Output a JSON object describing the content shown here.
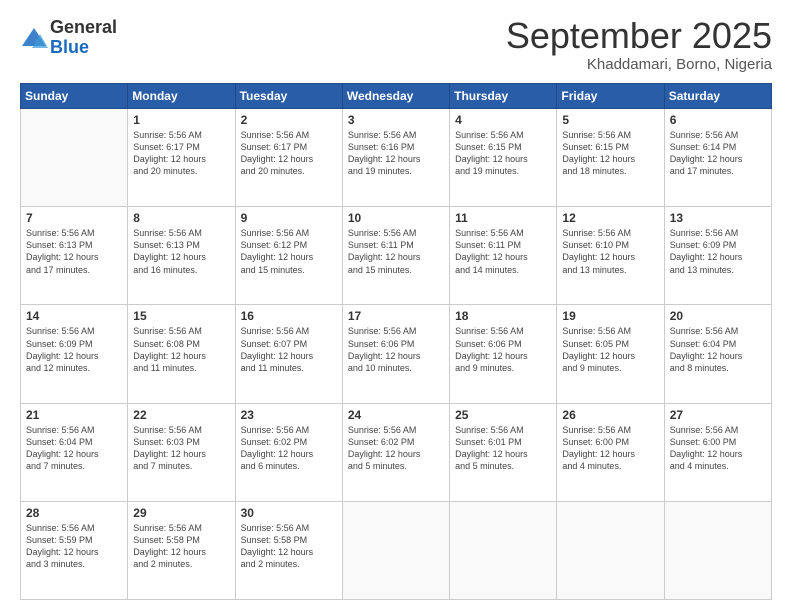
{
  "header": {
    "logo_general": "General",
    "logo_blue": "Blue",
    "month_title": "September 2025",
    "subtitle": "Khaddamari, Borno, Nigeria"
  },
  "days_of_week": [
    "Sunday",
    "Monday",
    "Tuesday",
    "Wednesday",
    "Thursday",
    "Friday",
    "Saturday"
  ],
  "weeks": [
    [
      {
        "day": "",
        "info": ""
      },
      {
        "day": "1",
        "info": "Sunrise: 5:56 AM\nSunset: 6:17 PM\nDaylight: 12 hours\nand 20 minutes."
      },
      {
        "day": "2",
        "info": "Sunrise: 5:56 AM\nSunset: 6:17 PM\nDaylight: 12 hours\nand 20 minutes."
      },
      {
        "day": "3",
        "info": "Sunrise: 5:56 AM\nSunset: 6:16 PM\nDaylight: 12 hours\nand 19 minutes."
      },
      {
        "day": "4",
        "info": "Sunrise: 5:56 AM\nSunset: 6:15 PM\nDaylight: 12 hours\nand 19 minutes."
      },
      {
        "day": "5",
        "info": "Sunrise: 5:56 AM\nSunset: 6:15 PM\nDaylight: 12 hours\nand 18 minutes."
      },
      {
        "day": "6",
        "info": "Sunrise: 5:56 AM\nSunset: 6:14 PM\nDaylight: 12 hours\nand 17 minutes."
      }
    ],
    [
      {
        "day": "7",
        "info": "Sunrise: 5:56 AM\nSunset: 6:13 PM\nDaylight: 12 hours\nand 17 minutes."
      },
      {
        "day": "8",
        "info": "Sunrise: 5:56 AM\nSunset: 6:13 PM\nDaylight: 12 hours\nand 16 minutes."
      },
      {
        "day": "9",
        "info": "Sunrise: 5:56 AM\nSunset: 6:12 PM\nDaylight: 12 hours\nand 15 minutes."
      },
      {
        "day": "10",
        "info": "Sunrise: 5:56 AM\nSunset: 6:11 PM\nDaylight: 12 hours\nand 15 minutes."
      },
      {
        "day": "11",
        "info": "Sunrise: 5:56 AM\nSunset: 6:11 PM\nDaylight: 12 hours\nand 14 minutes."
      },
      {
        "day": "12",
        "info": "Sunrise: 5:56 AM\nSunset: 6:10 PM\nDaylight: 12 hours\nand 13 minutes."
      },
      {
        "day": "13",
        "info": "Sunrise: 5:56 AM\nSunset: 6:09 PM\nDaylight: 12 hours\nand 13 minutes."
      }
    ],
    [
      {
        "day": "14",
        "info": "Sunrise: 5:56 AM\nSunset: 6:09 PM\nDaylight: 12 hours\nand 12 minutes."
      },
      {
        "day": "15",
        "info": "Sunrise: 5:56 AM\nSunset: 6:08 PM\nDaylight: 12 hours\nand 11 minutes."
      },
      {
        "day": "16",
        "info": "Sunrise: 5:56 AM\nSunset: 6:07 PM\nDaylight: 12 hours\nand 11 minutes."
      },
      {
        "day": "17",
        "info": "Sunrise: 5:56 AM\nSunset: 6:06 PM\nDaylight: 12 hours\nand 10 minutes."
      },
      {
        "day": "18",
        "info": "Sunrise: 5:56 AM\nSunset: 6:06 PM\nDaylight: 12 hours\nand 9 minutes."
      },
      {
        "day": "19",
        "info": "Sunrise: 5:56 AM\nSunset: 6:05 PM\nDaylight: 12 hours\nand 9 minutes."
      },
      {
        "day": "20",
        "info": "Sunrise: 5:56 AM\nSunset: 6:04 PM\nDaylight: 12 hours\nand 8 minutes."
      }
    ],
    [
      {
        "day": "21",
        "info": "Sunrise: 5:56 AM\nSunset: 6:04 PM\nDaylight: 12 hours\nand 7 minutes."
      },
      {
        "day": "22",
        "info": "Sunrise: 5:56 AM\nSunset: 6:03 PM\nDaylight: 12 hours\nand 7 minutes."
      },
      {
        "day": "23",
        "info": "Sunrise: 5:56 AM\nSunset: 6:02 PM\nDaylight: 12 hours\nand 6 minutes."
      },
      {
        "day": "24",
        "info": "Sunrise: 5:56 AM\nSunset: 6:02 PM\nDaylight: 12 hours\nand 5 minutes."
      },
      {
        "day": "25",
        "info": "Sunrise: 5:56 AM\nSunset: 6:01 PM\nDaylight: 12 hours\nand 5 minutes."
      },
      {
        "day": "26",
        "info": "Sunrise: 5:56 AM\nSunset: 6:00 PM\nDaylight: 12 hours\nand 4 minutes."
      },
      {
        "day": "27",
        "info": "Sunrise: 5:56 AM\nSunset: 6:00 PM\nDaylight: 12 hours\nand 4 minutes."
      }
    ],
    [
      {
        "day": "28",
        "info": "Sunrise: 5:56 AM\nSunset: 5:59 PM\nDaylight: 12 hours\nand 3 minutes."
      },
      {
        "day": "29",
        "info": "Sunrise: 5:56 AM\nSunset: 5:58 PM\nDaylight: 12 hours\nand 2 minutes."
      },
      {
        "day": "30",
        "info": "Sunrise: 5:56 AM\nSunset: 5:58 PM\nDaylight: 12 hours\nand 2 minutes."
      },
      {
        "day": "",
        "info": ""
      },
      {
        "day": "",
        "info": ""
      },
      {
        "day": "",
        "info": ""
      },
      {
        "day": "",
        "info": ""
      }
    ]
  ]
}
